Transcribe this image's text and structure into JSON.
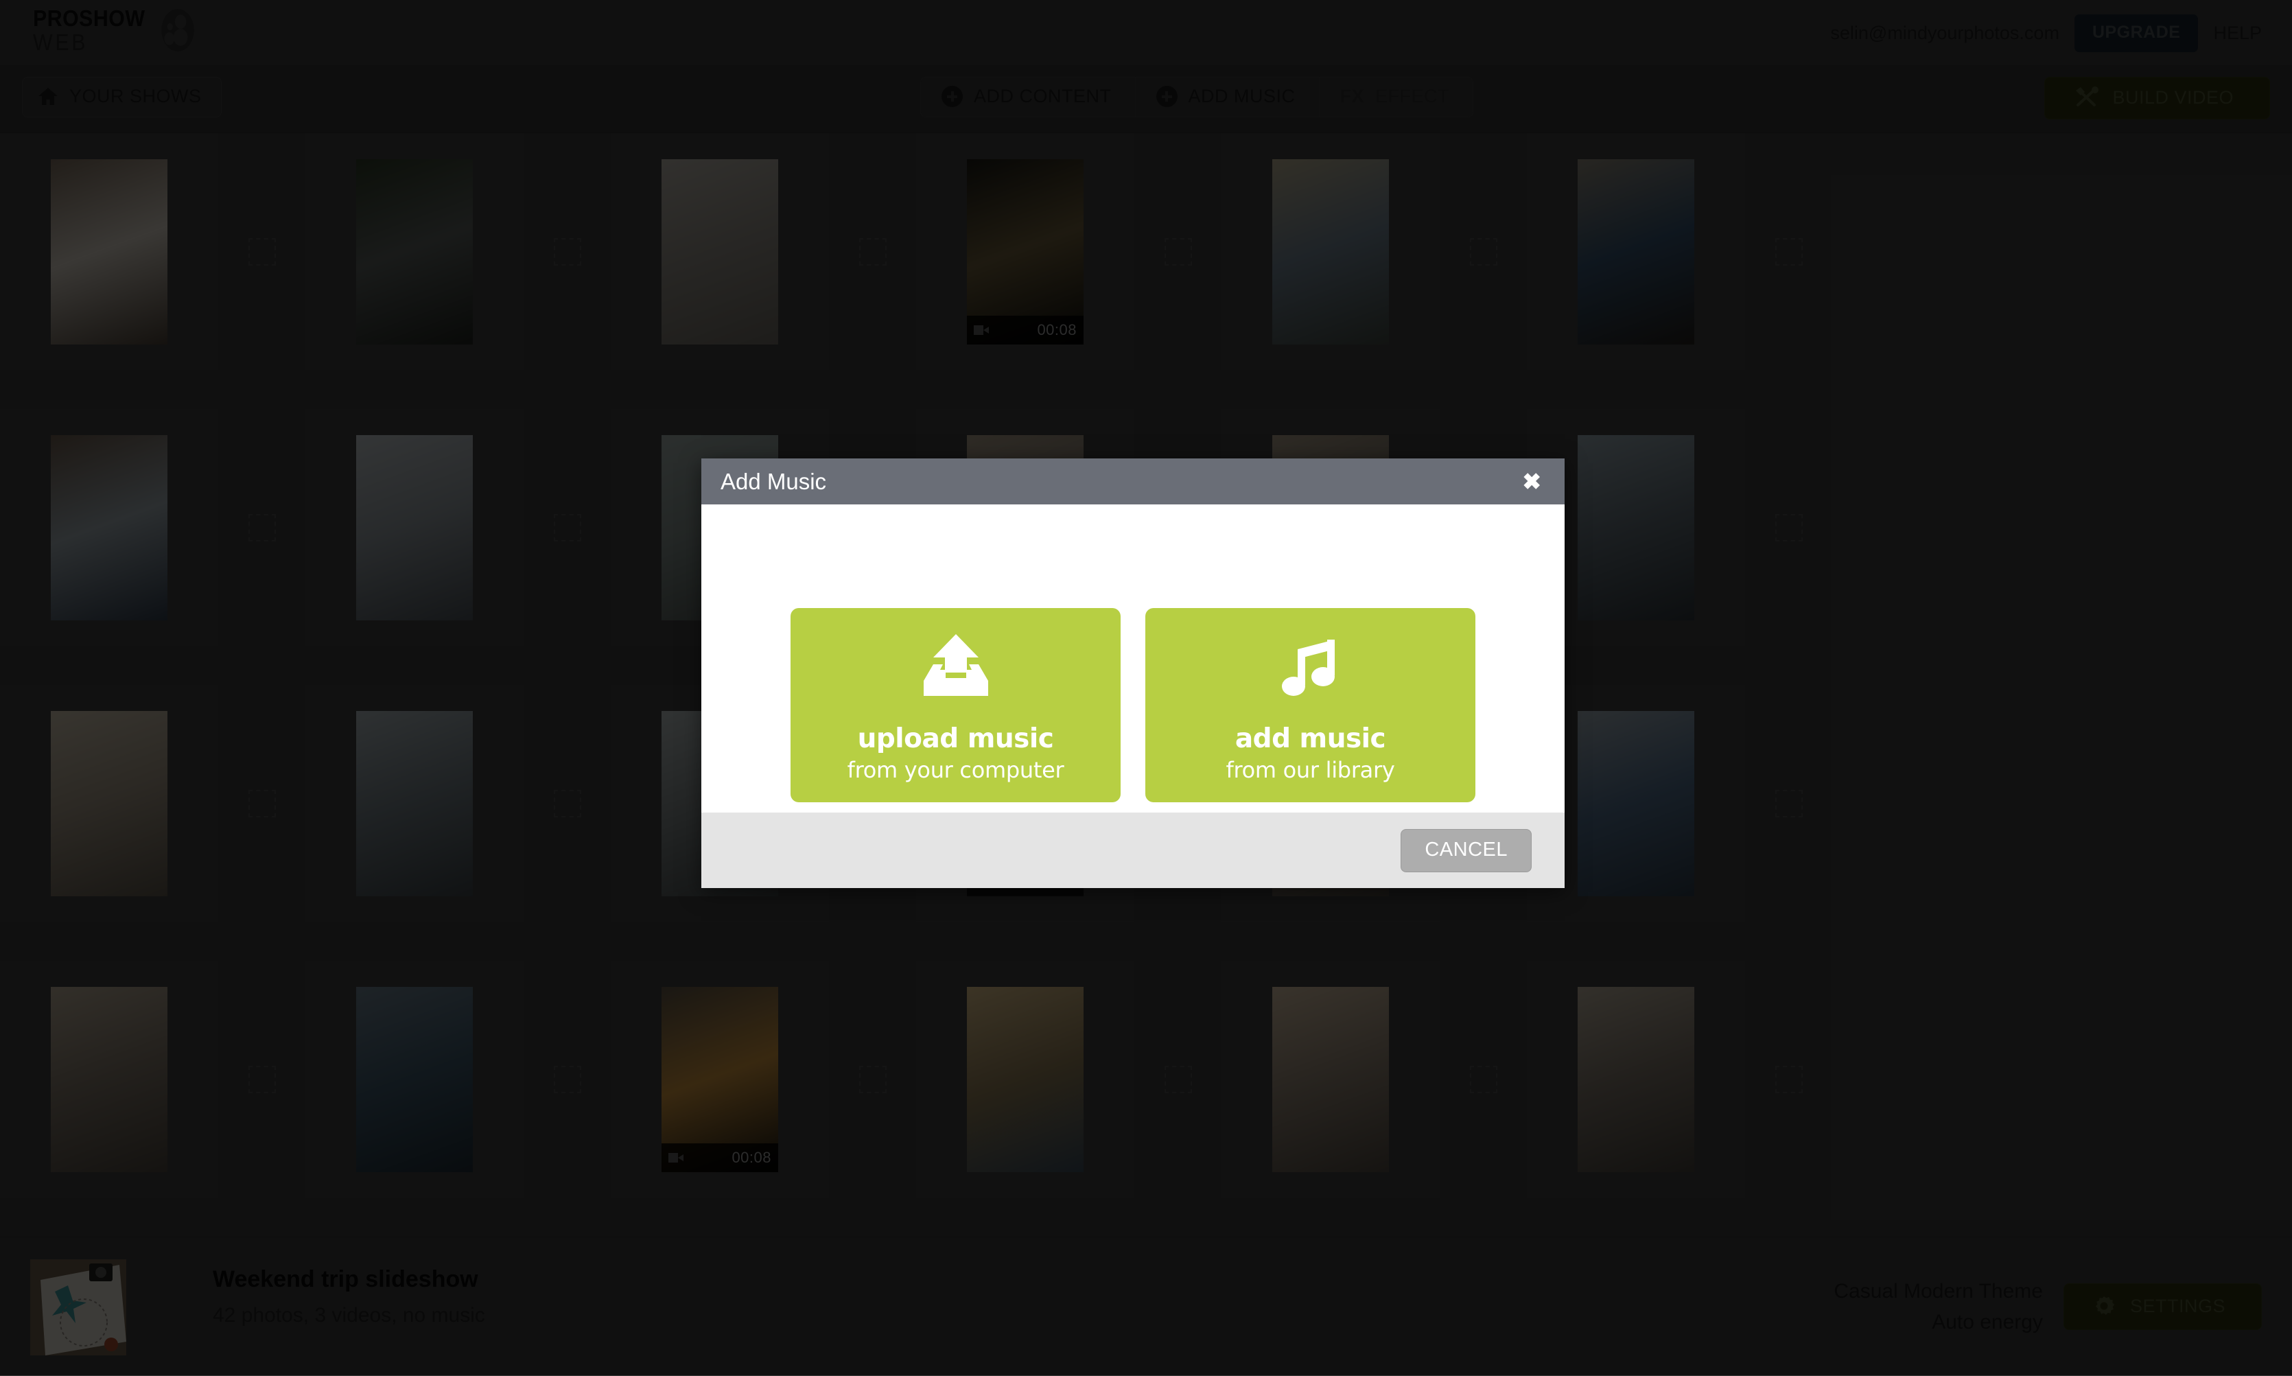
{
  "header": {
    "logo_primary": "PROSHOW",
    "logo_secondary": "WEB",
    "logo_icon": "film-reel-icon",
    "user_email": "selin@mindyourphotos.com",
    "upgrade_label": "UPGRADE",
    "help_label": "HELP",
    "accent_blue": "#16222e"
  },
  "toolbar": {
    "your_shows_label": "YOUR SHOWS",
    "your_shows_icon": "home-icon",
    "buttons": [
      {
        "label": "ADD CONTENT",
        "icon": "plus-circle-icon",
        "disabled": false
      },
      {
        "label": "ADD MUSIC",
        "icon": "plus-circle-icon",
        "disabled": false
      },
      {
        "label": "EFFECT",
        "icon": "fx-icon",
        "disabled": true
      }
    ],
    "build_label": "BUILD VIDEO",
    "build_icon": "hammer-wrench-icon",
    "build_color": "#2b3010"
  },
  "grid": {
    "drop_target_icon": "dashed-drop-target",
    "rows": [
      [
        {
          "kind": "photo",
          "alt": "lets-go-travel-notebook",
          "c1": "#7a6b5c",
          "c2": "#cfc8bd",
          "c3": "#4a4036"
        },
        {
          "kind": "photo",
          "alt": "hitchhiking-thumbs-up-road",
          "c1": "#2d3a26",
          "c2": "#5a5f5c",
          "c3": "#20241f"
        },
        {
          "kind": "photo",
          "alt": "map-and-pen-flatlay",
          "c1": "#b2ada4",
          "c2": "#8e8a82",
          "c3": "#6a665f"
        },
        {
          "kind": "video",
          "alt": "forest-sunrise-video",
          "duration": "00:08",
          "c1": "#1b1a14",
          "c2": "#6b5c3a",
          "c3": "#0d0d0a"
        },
        {
          "kind": "photo",
          "alt": "woman-in-tuk-tuk",
          "c1": "#b3a98d",
          "c2": "#6d7e8c",
          "c3": "#3f4640"
        },
        {
          "kind": "photo",
          "alt": "woman-with-sunglasses-car",
          "c1": "#8c8577",
          "c2": "#34506b",
          "c3": "#25201c"
        }
      ],
      [
        {
          "kind": "photo",
          "alt": "woman-back-at-beach",
          "c1": "#6a5a4c",
          "c2": "#9aa5ab",
          "c3": "#2f3b4a"
        },
        {
          "kind": "photo",
          "alt": "woman-arms-raised-ocean",
          "c1": "#b9bfc2",
          "c2": "#8e969b",
          "c3": "#4a5157"
        },
        {
          "kind": "photo",
          "alt": "tropical-shoreline",
          "c1": "#9ca8a4",
          "c2": "#7e8a86",
          "c3": "#4d5450"
        },
        {
          "kind": "photo",
          "alt": "beach-walk",
          "c1": "#a89b86",
          "c2": "#7c736a",
          "c3": "#473f38"
        },
        {
          "kind": "photo",
          "alt": "friends-sitting-on-sand",
          "c1": "#a79a85",
          "c2": "#6e675d",
          "c3": "#3e3a34"
        },
        {
          "kind": "photo",
          "alt": "bicycle-on-beach-sunset",
          "c1": "#93a3ab",
          "c2": "#5e6a72",
          "c3": "#2d3439"
        }
      ],
      [
        {
          "kind": "photo",
          "alt": "woman-with-hat-walking",
          "c1": "#c7bda9",
          "c2": "#9b907f",
          "c3": "#5b5449"
        },
        {
          "kind": "photo",
          "alt": "man-jumping-on-rock",
          "c1": "#a6b0b4",
          "c2": "#6f7a80",
          "c3": "#3c4347"
        },
        {
          "kind": "photo",
          "alt": "sea-foam-shoreline",
          "c1": "#aeb6b6",
          "c2": "#7d8484",
          "c3": "#454a4a"
        },
        {
          "kind": "photo",
          "alt": "feet-in-sand",
          "c1": "#b6a territ",
          "c2": "#85796b",
          "c3": "#4b433b"
        },
        {
          "kind": "photo",
          "alt": "walking-on-beach-sand",
          "c1": "#bdb09b",
          "c2": "#8a8072",
          "c3": "#4e4840"
        },
        {
          "kind": "photo",
          "alt": "two-women-in-ponchos",
          "c1": "#9aa6ae",
          "c2": "#4f6a86",
          "c3": "#2c3a47"
        }
      ],
      [
        {
          "kind": "photo",
          "alt": "couple-posing-on-beach",
          "c1": "#b5a894",
          "c2": "#7e7467",
          "c3": "#4a443c"
        },
        {
          "kind": "photo",
          "alt": "two-women-looking-at-phone",
          "c1": "#6b7d8a",
          "c2": "#3c5566",
          "c3": "#1f2c35"
        },
        {
          "kind": "video",
          "alt": "sunset-over-sea-video",
          "duration": "00:08",
          "c1": "#5e5445",
          "c2": "#c8903c",
          "c3": "#141310"
        },
        {
          "kind": "photo",
          "alt": "woman-photographing-sunset",
          "c1": "#d6bb86",
          "c2": "#8d7a55",
          "c3": "#3a4a56"
        },
        {
          "kind": "photo",
          "alt": "woman-with-camera-closeup",
          "c1": "#cbb79c",
          "c2": "#8d8070",
          "c3": "#4f4840"
        },
        {
          "kind": "photo",
          "alt": "woman-sitting-by-water",
          "c1": "#b6ab99",
          "c2": "#7a7166",
          "c3": "#44403a"
        }
      ]
    ]
  },
  "footer": {
    "show_title": "Weekend trip slideshow",
    "show_meta": "42 photos, 3 videos, no music",
    "theme_name": "Casual Modern Theme",
    "energy": "Auto energy",
    "settings_label": "SETTINGS",
    "settings_icon": "gear-icon",
    "thumbnail_alt": "lets-go-travel-notebook"
  },
  "modal": {
    "title": "Add Music",
    "close_icon": "close-x-icon",
    "cancel_label": "CANCEL",
    "accent_green": "#b7cf43",
    "options": [
      {
        "icon": "upload-tray-icon",
        "main": "upload music",
        "sub": "from your computer"
      },
      {
        "icon": "music-note-icon",
        "main": "add music",
        "sub": "from our library"
      }
    ]
  }
}
